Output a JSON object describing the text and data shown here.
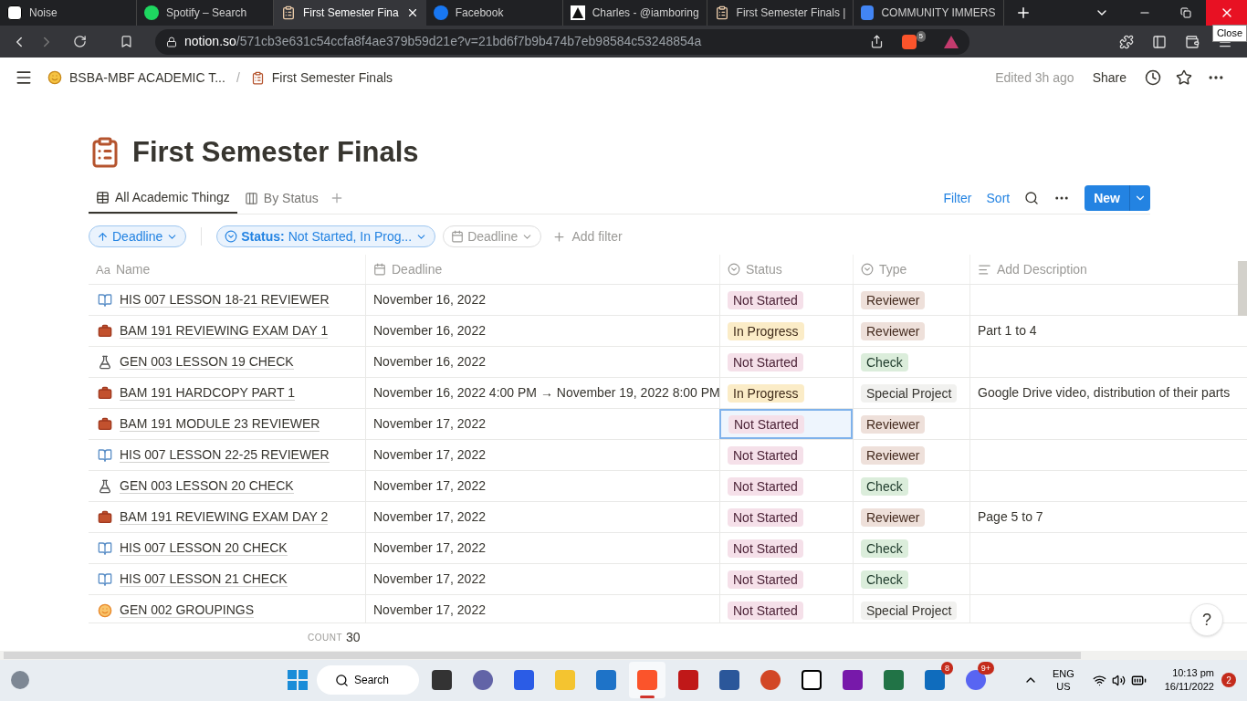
{
  "browser_tabs": [
    {
      "kind": "notion",
      "title": "Noise",
      "selected": false
    },
    {
      "kind": "spotify",
      "title": "Spotify – Search",
      "selected": false
    },
    {
      "kind": "clipboard",
      "title": "First Semester Fina",
      "selected": true
    },
    {
      "kind": "facebook",
      "title": "Facebook",
      "selected": false
    },
    {
      "kind": "triangle",
      "title": "Charles - @iamboring",
      "selected": false
    },
    {
      "kind": "clipboard",
      "title": "First Semester Finals |",
      "selected": false
    },
    {
      "kind": "docs",
      "title": "COMMUNITY IMMERS",
      "selected": false
    }
  ],
  "tooltip": "Close",
  "address": {
    "domain": "notion.so",
    "path": "/571cb3e631c54ccfa8f4ae379b59d21e?v=21bd6f7b9b474b7eb98584c53248854a"
  },
  "extension_badge": "5",
  "breadcrumb": [
    "BSBA-MBF ACADEMIC T...",
    "First Semester Finals"
  ],
  "breadcrumb_separator": "/",
  "topbar": {
    "edited": "Edited 3h ago",
    "share": "Share"
  },
  "page_title": "First Semester Finals",
  "views": [
    {
      "label": "All Academic Thingz",
      "kind": "table",
      "selected": true
    },
    {
      "label": "By Status",
      "kind": "board",
      "selected": false
    }
  ],
  "actions": {
    "filter": "Filter",
    "sort": "Sort",
    "new": "New"
  },
  "filters": [
    {
      "kind": "sort",
      "label": "Deadline",
      "active": true
    },
    {
      "kind": "status",
      "prefix": "Status:",
      "label": "Not Started, In Prog...",
      "active": true
    },
    {
      "kind": "date",
      "label": "Deadline",
      "active": false
    },
    {
      "kind": "add",
      "label": "Add filter"
    }
  ],
  "table": {
    "columns": [
      {
        "kind": "title",
        "label": "Name",
        "prefix": "Aa"
      },
      {
        "kind": "date",
        "label": "Deadline"
      },
      {
        "kind": "select",
        "label": "Status"
      },
      {
        "kind": "select",
        "label": "Type"
      },
      {
        "kind": "text",
        "label": "Add Description"
      }
    ],
    "rows": [
      {
        "kind": "book",
        "name": "HIS 007 LESSON 18-21 REVIEWER",
        "deadline": "November 16, 2022",
        "status": {
          "label": "Not Started",
          "kind": "not_started",
          "selected": false
        },
        "type": {
          "label": "Reviewer",
          "kind": "reviewer"
        },
        "description": ""
      },
      {
        "kind": "briefcase",
        "name": "BAM 191 REVIEWING EXAM DAY 1",
        "deadline": "November 16, 2022",
        "status": {
          "label": "In Progress",
          "kind": "in_progress",
          "selected": false
        },
        "type": {
          "label": "Reviewer",
          "kind": "reviewer"
        },
        "description": "Part 1 to 4"
      },
      {
        "kind": "flask",
        "name": "GEN 003 LESSON 19 CHECK",
        "deadline": "November 16, 2022",
        "status": {
          "label": "Not Started",
          "kind": "not_started",
          "selected": false
        },
        "type": {
          "label": "Check",
          "kind": "check"
        },
        "description": ""
      },
      {
        "kind": "briefcase",
        "name": "BAM 191 HARDCOPY PART 1",
        "deadline": "November 16, 2022 4:00 PM → November 19, 2022 8:00 PM",
        "status": {
          "label": "In Progress",
          "kind": "in_progress",
          "selected": false
        },
        "type": {
          "label": "Special Project",
          "kind": "special"
        },
        "description": "Google Drive video, distribution of their parts"
      },
      {
        "kind": "briefcase",
        "name": "BAM 191 MODULE 23 REVIEWER",
        "deadline": "November 17, 2022",
        "status": {
          "label": "Not Started",
          "kind": "not_started",
          "selected": true
        },
        "type": {
          "label": "Reviewer",
          "kind": "reviewer"
        },
        "description": ""
      },
      {
        "kind": "book",
        "name": "HIS 007 LESSON 22-25 REVIEWER",
        "deadline": "November 17, 2022",
        "status": {
          "label": "Not Started",
          "kind": "not_started",
          "selected": false
        },
        "type": {
          "label": "Reviewer",
          "kind": "reviewer"
        },
        "description": ""
      },
      {
        "kind": "flask",
        "name": "GEN 003 LESSON 20 CHECK",
        "deadline": "November 17, 2022",
        "status": {
          "label": "Not Started",
          "kind": "not_started",
          "selected": false
        },
        "type": {
          "label": "Check",
          "kind": "check"
        },
        "description": ""
      },
      {
        "kind": "briefcase",
        "name": "BAM 191 REVIEWING EXAM DAY 2",
        "deadline": "November 17, 2022",
        "status": {
          "label": "Not Started",
          "kind": "not_started",
          "selected": false
        },
        "type": {
          "label": "Reviewer",
          "kind": "reviewer"
        },
        "description": "Page 5 to 7"
      },
      {
        "kind": "book",
        "name": "HIS 007 LESSON 20 CHECK",
        "deadline": "November 17, 2022",
        "status": {
          "label": "Not Started",
          "kind": "not_started",
          "selected": false
        },
        "type": {
          "label": "Check",
          "kind": "check"
        },
        "description": ""
      },
      {
        "kind": "book",
        "name": "HIS 007 LESSON 21 CHECK",
        "deadline": "November 17, 2022",
        "status": {
          "label": "Not Started",
          "kind": "not_started",
          "selected": false
        },
        "type": {
          "label": "Check",
          "kind": "check"
        },
        "description": ""
      },
      {
        "kind": "person",
        "name": "GEN 002 GROUPINGS",
        "deadline": "November 17, 2022",
        "status": {
          "label": "Not Started",
          "kind": "not_started",
          "selected": false
        },
        "type": {
          "label": "Special Project",
          "kind": "special"
        },
        "description": ""
      }
    ],
    "count_label": "COUNT",
    "count": "30"
  },
  "help": "?",
  "taskbar": {
    "search": "Search",
    "apps": [
      {
        "kind": "files",
        "active": false
      },
      {
        "kind": "meet",
        "active": false
      },
      {
        "kind": "pen",
        "active": false
      },
      {
        "kind": "folder",
        "active": false
      },
      {
        "kind": "store",
        "active": false
      },
      {
        "kind": "brave",
        "active": true
      },
      {
        "kind": "shield",
        "active": false
      },
      {
        "kind": "word",
        "active": false
      },
      {
        "kind": "powerpoint",
        "active": false
      },
      {
        "kind": "notion",
        "active": false
      },
      {
        "kind": "onenote",
        "active": false
      },
      {
        "kind": "excel",
        "active": false
      },
      {
        "kind": "phone",
        "active": false,
        "badge": "8"
      },
      {
        "kind": "discord",
        "active": false,
        "badge": "9+"
      }
    ],
    "language": "ENG",
    "region": "US",
    "time": "10:13 pm",
    "date": "16/11/2022",
    "notifications": "2"
  }
}
